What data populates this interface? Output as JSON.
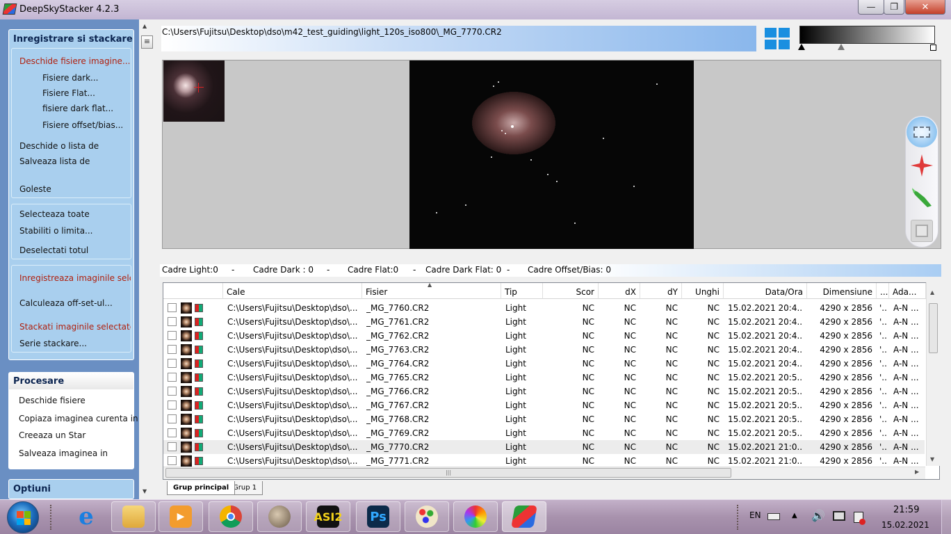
{
  "window": {
    "title": "DeepSkyStacker 4.2.3",
    "min": "—",
    "max": "❐",
    "close": "✕"
  },
  "sidebar": {
    "register_group": {
      "title": "Inregistrare si stackare",
      "open_items": [
        "Deschide fisiere imagine...",
        "Fisiere dark...",
        "Fisiere Flat...",
        "fisiere dark flat...",
        "Fisiere offset/bias...",
        "Deschide o lista de",
        "Salveaza lista de",
        "Goleste"
      ],
      "select_items": [
        "Selecteaza toate",
        "Stabiliti o limita...",
        "Deselectati totul"
      ],
      "stack_items": [
        "Inregistreaza imaginile selecta",
        "Calculeaza off-set-ul...",
        "Stackati imaginile selectate...",
        "Serie stackare..."
      ]
    },
    "processing_group": {
      "title": "Procesare",
      "items": [
        "Deschide fisiere",
        "Copiaza imaginea curenta in",
        "Creeaza un Star",
        "Salveaza imaginea in"
      ]
    },
    "options_group": {
      "title": "Optiuni"
    }
  },
  "path": "C:\\Users\\Fujitsu\\Desktop\\dso\\m42_test_guiding\\light_120s_iso800\\_MG_7770.CR2",
  "status": {
    "light": "Cadre Light:0",
    "sep": "-",
    "dark": "Cadre Dark : 0",
    "flat": "Cadre Flat:0",
    "dark_flat": "Cadre Dark Flat: 0",
    "offset": "Cadre Offset/Bias: 0"
  },
  "table": {
    "columns": [
      "Cale",
      "Fisier",
      "Tip",
      "Scor",
      "dX",
      "dY",
      "Unghi",
      "Data/Ora",
      "Dimensiune",
      "...",
      "Ada..."
    ],
    "rows": [
      {
        "path": "C:\\Users\\Fujitsu\\Desktop\\dso\\...",
        "file": "_MG_7760.CR2",
        "type": "Light",
        "score": "NC",
        "dx": "NC",
        "dy": "NC",
        "angle": "NC",
        "date": "15.02.2021 20:4...",
        "size": "4290 x 2856",
        "c": "'...",
        "ada": "A-N ..."
      },
      {
        "path": "C:\\Users\\Fujitsu\\Desktop\\dso\\...",
        "file": "_MG_7761.CR2",
        "type": "Light",
        "score": "NC",
        "dx": "NC",
        "dy": "NC",
        "angle": "NC",
        "date": "15.02.2021 20:4...",
        "size": "4290 x 2856",
        "c": "'...",
        "ada": "A-N ..."
      },
      {
        "path": "C:\\Users\\Fujitsu\\Desktop\\dso\\...",
        "file": "_MG_7762.CR2",
        "type": "Light",
        "score": "NC",
        "dx": "NC",
        "dy": "NC",
        "angle": "NC",
        "date": "15.02.2021 20:4...",
        "size": "4290 x 2856",
        "c": "'...",
        "ada": "A-N ..."
      },
      {
        "path": "C:\\Users\\Fujitsu\\Desktop\\dso\\...",
        "file": "_MG_7763.CR2",
        "type": "Light",
        "score": "NC",
        "dx": "NC",
        "dy": "NC",
        "angle": "NC",
        "date": "15.02.2021 20:4...",
        "size": "4290 x 2856",
        "c": "'...",
        "ada": "A-N ..."
      },
      {
        "path": "C:\\Users\\Fujitsu\\Desktop\\dso\\...",
        "file": "_MG_7764.CR2",
        "type": "Light",
        "score": "NC",
        "dx": "NC",
        "dy": "NC",
        "angle": "NC",
        "date": "15.02.2021 20:4...",
        "size": "4290 x 2856",
        "c": "'...",
        "ada": "A-N ..."
      },
      {
        "path": "C:\\Users\\Fujitsu\\Desktop\\dso\\...",
        "file": "_MG_7765.CR2",
        "type": "Light",
        "score": "NC",
        "dx": "NC",
        "dy": "NC",
        "angle": "NC",
        "date": "15.02.2021 20:5...",
        "size": "4290 x 2856",
        "c": "'...",
        "ada": "A-N ..."
      },
      {
        "path": "C:\\Users\\Fujitsu\\Desktop\\dso\\...",
        "file": "_MG_7766.CR2",
        "type": "Light",
        "score": "NC",
        "dx": "NC",
        "dy": "NC",
        "angle": "NC",
        "date": "15.02.2021 20:5...",
        "size": "4290 x 2856",
        "c": "'...",
        "ada": "A-N ..."
      },
      {
        "path": "C:\\Users\\Fujitsu\\Desktop\\dso\\...",
        "file": "_MG_7767.CR2",
        "type": "Light",
        "score": "NC",
        "dx": "NC",
        "dy": "NC",
        "angle": "NC",
        "date": "15.02.2021 20:5...",
        "size": "4290 x 2856",
        "c": "'...",
        "ada": "A-N ..."
      },
      {
        "path": "C:\\Users\\Fujitsu\\Desktop\\dso\\...",
        "file": "_MG_7768.CR2",
        "type": "Light",
        "score": "NC",
        "dx": "NC",
        "dy": "NC",
        "angle": "NC",
        "date": "15.02.2021 20:5...",
        "size": "4290 x 2856",
        "c": "'...",
        "ada": "A-N ..."
      },
      {
        "path": "C:\\Users\\Fujitsu\\Desktop\\dso\\...",
        "file": "_MG_7769.CR2",
        "type": "Light",
        "score": "NC",
        "dx": "NC",
        "dy": "NC",
        "angle": "NC",
        "date": "15.02.2021 20:5...",
        "size": "4290 x 2856",
        "c": "'...",
        "ada": "A-N ..."
      },
      {
        "path": "C:\\Users\\Fujitsu\\Desktop\\dso\\...",
        "file": "_MG_7770.CR2",
        "type": "Light",
        "score": "NC",
        "dx": "NC",
        "dy": "NC",
        "angle": "NC",
        "date": "15.02.2021 21:0...",
        "size": "4290 x 2856",
        "c": "'...",
        "ada": "A-N ..."
      },
      {
        "path": "C:\\Users\\Fujitsu\\Desktop\\dso\\...",
        "file": "_MG_7771.CR2",
        "type": "Light",
        "score": "NC",
        "dx": "NC",
        "dy": "NC",
        "angle": "NC",
        "date": "15.02.2021 21:0...",
        "size": "4290 x 2856",
        "c": "'...",
        "ada": "A-N ..."
      }
    ]
  },
  "tabs": [
    "Grup principal",
    "Grup 1"
  ],
  "taskbar": {
    "apps": [
      "internet-explorer-icon",
      "file-explorer-icon",
      "media-player-icon",
      "chrome-icon",
      "planet-icon",
      "asi-icon",
      "photoshop-icon",
      "paint-icon",
      "photos-icon",
      "deepskystacker-icon"
    ],
    "asi_label": "ASI2",
    "ps_label": "Ps",
    "lang": "EN",
    "time": "21:59",
    "date": "15.02.2021"
  }
}
